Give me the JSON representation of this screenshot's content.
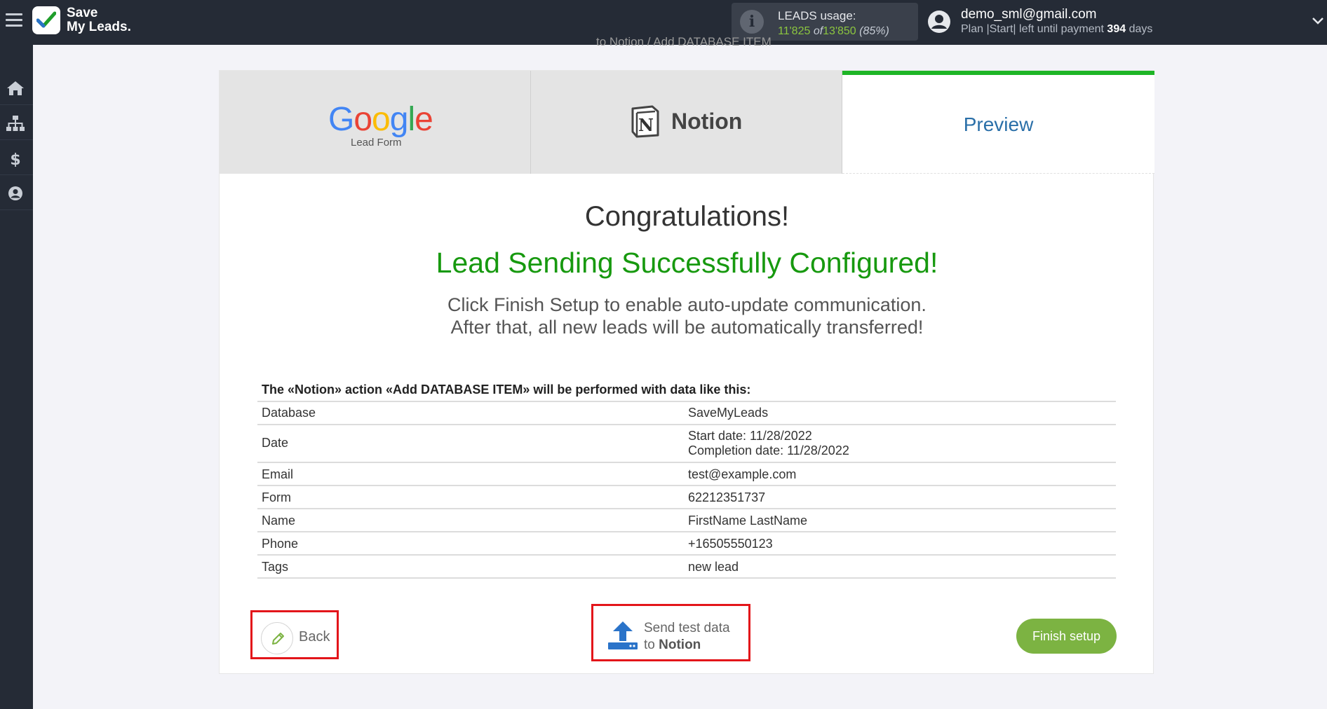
{
  "app": {
    "logo_line1": "Save",
    "logo_line2": "My Leads."
  },
  "usage": {
    "label": "LEADS usage:",
    "used": "11'825",
    "of": "of",
    "total": "13'850",
    "percent": "(85%)"
  },
  "account": {
    "email": "demo_sml@gmail.com",
    "plan_prefix": "Plan |Start| left until payment",
    "days_value": "394",
    "days_label": "days"
  },
  "page": {
    "subtitle": "to Notion / Add DATABASE ITEM"
  },
  "tabs": {
    "google_word": "Google",
    "google_sub": "Lead Form",
    "notion": "Notion",
    "preview": "Preview"
  },
  "content": {
    "congrats": "Congratulations!",
    "success": "Lead Sending Successfully Configured!",
    "desc_line1": "Click Finish Setup to enable auto-update communication.",
    "desc_line2": "After that, all new leads will be automatically transferred!",
    "action_title": "The «Notion» action «Add DATABASE ITEM» will be performed with data like this:"
  },
  "table": {
    "rows": [
      {
        "key": "Database",
        "value": "SaveMyLeads"
      },
      {
        "key": "Date",
        "value": "Start date: 11/28/2022",
        "value2": "Completion date: 11/28/2022"
      },
      {
        "key": "Email",
        "value": "test@example.com"
      },
      {
        "key": "Form",
        "value": "62212351737"
      },
      {
        "key": "Name",
        "value": "FirstName LastName"
      },
      {
        "key": "Phone",
        "value": "+16505550123"
      },
      {
        "key": "Tags",
        "value": "new lead"
      }
    ]
  },
  "buttons": {
    "back": "Back",
    "send_line1": "Send test data",
    "send_to": "to",
    "send_target": "Notion",
    "finish": "Finish setup"
  },
  "colors": {
    "topbar": "#252b36",
    "success_green": "#17990f",
    "progress_green": "#1eb526",
    "finish_button": "#7cb342",
    "highlight_red": "#e3151a",
    "preview_blue": "#2a6fa8"
  },
  "icons": {
    "menu": "hamburger-icon",
    "logo": "checkmark-logo-icon",
    "info": "info-icon",
    "user": "user-avatar-icon",
    "dropdown": "chevron-down-icon",
    "home": "home-icon",
    "sitemap": "sitemap-icon",
    "billing": "dollar-icon",
    "profile": "profile-icon",
    "back": "pencil-icon",
    "send": "upload-icon"
  }
}
